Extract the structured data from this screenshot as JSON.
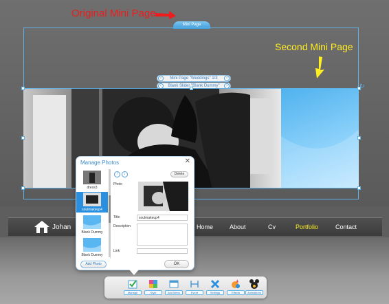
{
  "annotations": {
    "original": "Original Mini Page",
    "second": "Second Mini Page"
  },
  "mini_page_tab": "Mini Page",
  "sliders": {
    "mini_page": "Mini Page \"Weddings\" 1/3",
    "blank_slider": "Blank Slider \"Blank Dummy\""
  },
  "nav": {
    "logo": "Johan",
    "items": [
      "Home",
      "About",
      "Cv",
      "Portfolio",
      "Contact"
    ],
    "active_color": "#ffee22"
  },
  "dialog": {
    "title": "Manage Photos",
    "delete": "Delete",
    "thumbs": [
      "dress3",
      "soulmakeup4",
      "Blank Dummy",
      "Blank Dummy"
    ],
    "photo_label": "Photo",
    "title_label": "Title",
    "title_value": "soulmakeup4",
    "description_label": "Description",
    "link_label": "Link",
    "add_photo": "Add Photo",
    "ok": "OK"
  },
  "toolbar": [
    "Manage",
    "Style",
    "Add Menu",
    "Event",
    "Settings",
    "Effects",
    "Animations"
  ],
  "colors": {
    "accent": "#5fb2e6",
    "annotation_red": "#ee1c1c",
    "annotation_yellow": "#ffee22"
  }
}
